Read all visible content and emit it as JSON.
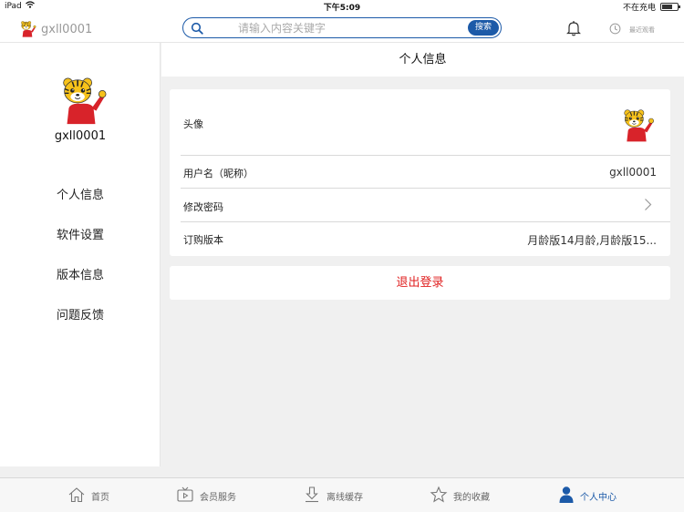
{
  "status_bar": {
    "device": "iPad",
    "time": "下午5:09",
    "charging": "不在充电",
    "battery_level": 0.7
  },
  "header": {
    "brand_name": "gxll0001",
    "search": {
      "placeholder": "请输入内容关键字",
      "value": "",
      "button_label": "搜索"
    },
    "recent_label": "最近观看"
  },
  "sidebar": {
    "username": "gxll0001",
    "items": [
      {
        "label": "个人信息"
      },
      {
        "label": "软件设置"
      },
      {
        "label": "版本信息"
      },
      {
        "label": "问题反馈"
      }
    ]
  },
  "main": {
    "title": "个人信息",
    "rows": {
      "avatar": {
        "label": "头像"
      },
      "username": {
        "label": "用户名（昵称）",
        "value": "gxll0001"
      },
      "password": {
        "label": "修改密码"
      },
      "version": {
        "label": "订购版本",
        "value": "月龄版14月龄,月龄版15..."
      }
    },
    "logout_label": "退出登录"
  },
  "tabbar": {
    "items": [
      {
        "label": "首页",
        "icon": "home-icon"
      },
      {
        "label": "会员服务",
        "icon": "tv-icon"
      },
      {
        "label": "离线缓存",
        "icon": "download-icon"
      },
      {
        "label": "我的收藏",
        "icon": "star-icon"
      },
      {
        "label": "个人中心",
        "icon": "person-icon"
      }
    ],
    "active_index": 4
  },
  "colors": {
    "accent": "#1c5aa8",
    "logout": "#e02020",
    "background": "#f0f0f0"
  }
}
